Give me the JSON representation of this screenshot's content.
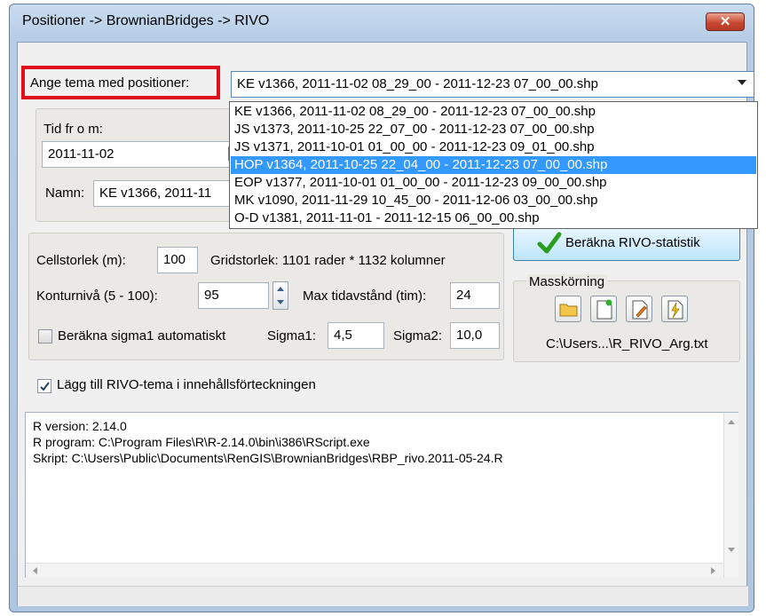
{
  "window": {
    "title": "Positioner -> BrownianBridges -> RIVO",
    "close_label": "✕"
  },
  "theme": {
    "label": "Ange tema med positioner:",
    "selected": "KE v1366, 2011-11-02 08_29_00 - 2011-12-23 07_00_00.shp",
    "options": [
      "KE v1366, 2011-11-02 08_29_00 - 2011-12-23 07_00_00.shp",
      "JS v1373, 2011-10-25 22_07_00 - 2011-12-23 07_00_00.shp",
      "JS v1371, 2011-10-01 01_00_00 - 2011-12-23 09_01_00.shp",
      "HOP v1364, 2011-10-25 22_04_00 - 2011-12-23 07_00_00.shp",
      "EOP v1377, 2011-10-01 01_00_00 - 2011-12-23 09_00_00.shp",
      "MK v1090, 2011-11-29 10_45_00 - 2011-12-06 03_00_00.shp",
      "O-D v1381, 2011-11-01 - 2011-12-15 06_00_00.shp"
    ],
    "highlighted_index": 3
  },
  "time": {
    "from_label": "Tid fr o m:",
    "from_value": "2011-11-02",
    "name_label": "Namn:",
    "name_value": "KE v1366, 2011-11"
  },
  "grid": {
    "cell_label": "Cellstorlek (m):",
    "cell_value": "100",
    "grid_size_text": "Gridstorlek: 1101 rader * 1132 kolumner",
    "contour_label": "Konturnivå (5 - 100):",
    "contour_value": "95",
    "max_time_label": "Max tidavstånd (tim):",
    "max_time_value": "24",
    "auto_sigma_label": "Beräkna sigma1 automatiskt",
    "sigma1_label": "Sigma1:",
    "sigma1_value": "4,5",
    "sigma2_label": "Sigma2:",
    "sigma2_value": "10,0"
  },
  "compute": {
    "button_label": "Beräkna RIVO-statistik"
  },
  "batch": {
    "label": "Masskörning",
    "path": "C:\\Users...\\R_RIVO_Arg.txt"
  },
  "add_to_toc": {
    "label": "Lägg till RIVO-tema i innehållsförteckningen",
    "checked": true
  },
  "log": {
    "lines": [
      "R version: 2.14.0",
      "R program: C:\\Program Files\\R\\R-2.14.0\\bin\\i386\\RScript.exe",
      "Skript: C:\\Users\\Public\\Documents\\RenGIS\\BrownianBridges\\RBP_rivo.2011-05-24.R"
    ]
  },
  "colors": {
    "highlight": "#3399ff",
    "annotation_red": "#e0101a",
    "check_green": "#2a9d1e"
  }
}
